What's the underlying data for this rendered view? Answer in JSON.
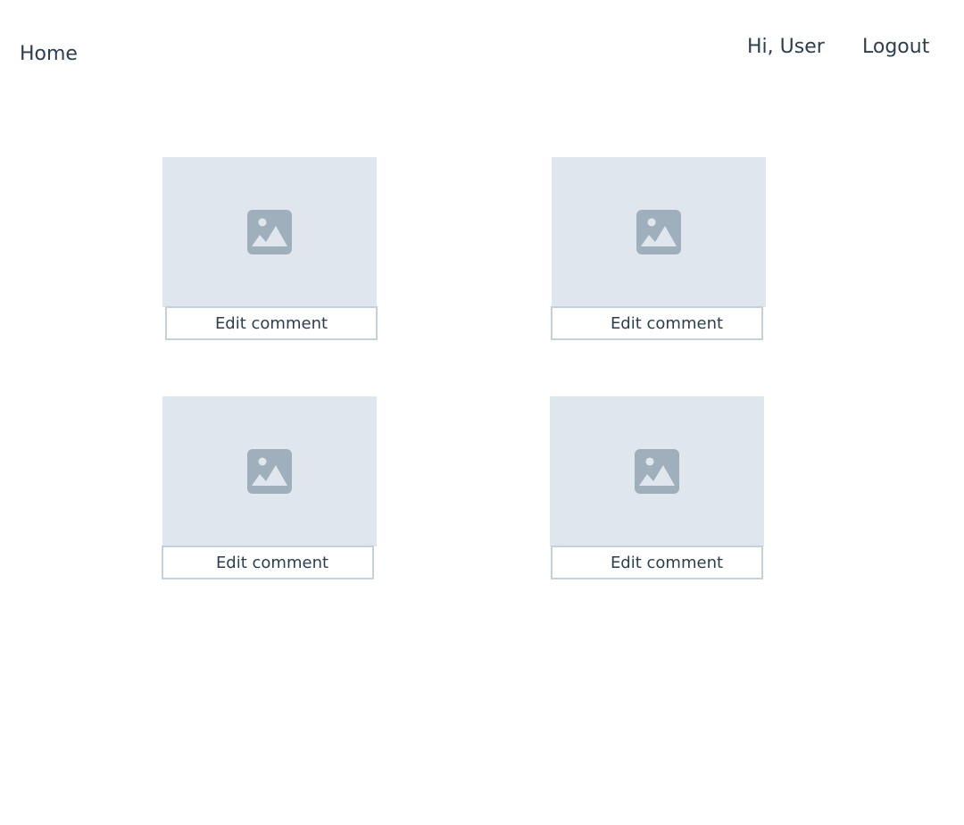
{
  "header": {
    "home_label": "Home",
    "greeting": "Hi, User",
    "logout_label": "Logout"
  },
  "colors": {
    "text": "#2c3e50",
    "placeholder_bg": "#e0e6ee",
    "placeholder_icon": "#a0afbc",
    "button_border": "#c4d0db"
  },
  "cards": [
    {
      "image_icon": "image-placeholder-icon",
      "edit_label": "Edit comment"
    },
    {
      "image_icon": "image-placeholder-icon",
      "edit_label": "Edit comment"
    },
    {
      "image_icon": "image-placeholder-icon",
      "edit_label": "Edit comment"
    },
    {
      "image_icon": "image-placeholder-icon",
      "edit_label": "Edit comment"
    }
  ]
}
